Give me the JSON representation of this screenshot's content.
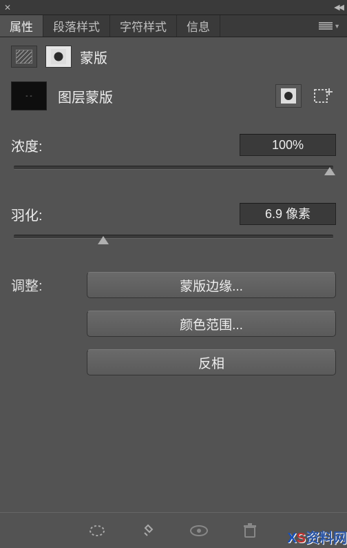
{
  "tabs": {
    "properties": "属性",
    "paragraph": "段落样式",
    "character": "字符样式",
    "info": "信息"
  },
  "header": {
    "title": "蒙版"
  },
  "preview": {
    "label": "图层蒙版",
    "thumb_placeholder": "- -"
  },
  "sliders": {
    "density": {
      "label": "浓度:",
      "value": "100%",
      "pos": 100
    },
    "feather": {
      "label": "羽化:",
      "value": "6.9 像素",
      "pos": 28
    }
  },
  "adjust": {
    "label": "调整:",
    "mask_edge": "蒙版边缘...",
    "color_range": "颜色范围...",
    "invert": "反相"
  },
  "watermark": "资料网"
}
